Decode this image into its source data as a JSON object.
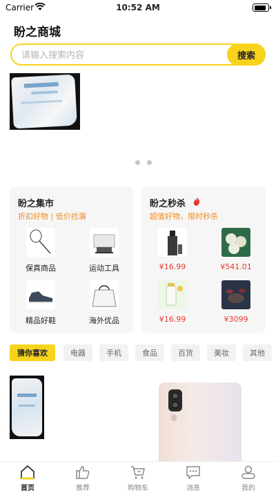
{
  "status_bar": {
    "carrier": "Carrier",
    "time": "10:52 AM",
    "battery_level": 0.9
  },
  "app_title": "盼之商城",
  "search": {
    "placeholder": "请输入搜索内容",
    "value": "",
    "button_label": "搜索"
  },
  "banner": {
    "page_count": 2,
    "active_index": 0
  },
  "market_card": {
    "title": "盼之集市",
    "subtitle": "折扣好物 | 低价捡漏",
    "items": [
      {
        "label": "保真商品",
        "icon": "badminton-racket-image"
      },
      {
        "label": "运动工具",
        "icon": "gym-equipment-image"
      },
      {
        "label": "精品好鞋",
        "icon": "sneaker-image"
      },
      {
        "label": "海外优品",
        "icon": "handbag-image"
      }
    ]
  },
  "flash_card": {
    "title": "盼之秒杀",
    "subtitle": "超值好物，限时秒杀",
    "icon": "fire-icon",
    "items": [
      {
        "price": "¥16.99",
        "icon": "cosmetic-bottle-image"
      },
      {
        "price": "¥541.01",
        "icon": "tea-cakes-image"
      },
      {
        "price": "¥16.99",
        "icon": "drink-bottle-image"
      },
      {
        "price": "¥3099",
        "icon": "tea-set-image"
      }
    ]
  },
  "categories": [
    {
      "label": "猜你喜欢",
      "active": true
    },
    {
      "label": "电器",
      "active": false
    },
    {
      "label": "手机",
      "active": false
    },
    {
      "label": "食品",
      "active": false
    },
    {
      "label": "百货",
      "active": false
    },
    {
      "label": "美妆",
      "active": false
    },
    {
      "label": "其他",
      "active": false
    }
  ],
  "tabbar": [
    {
      "label": "首页",
      "icon": "home-icon",
      "active": true
    },
    {
      "label": "推荐",
      "icon": "thumbs-up-icon",
      "active": false
    },
    {
      "label": "购物车",
      "icon": "cart-icon",
      "active": false
    },
    {
      "label": "消息",
      "icon": "message-icon",
      "active": false
    },
    {
      "label": "我的",
      "icon": "user-icon",
      "active": false
    }
  ],
  "colors": {
    "accent": "#f8d31c",
    "price": "#e43a2f",
    "subtitle": "#f08c1e"
  }
}
